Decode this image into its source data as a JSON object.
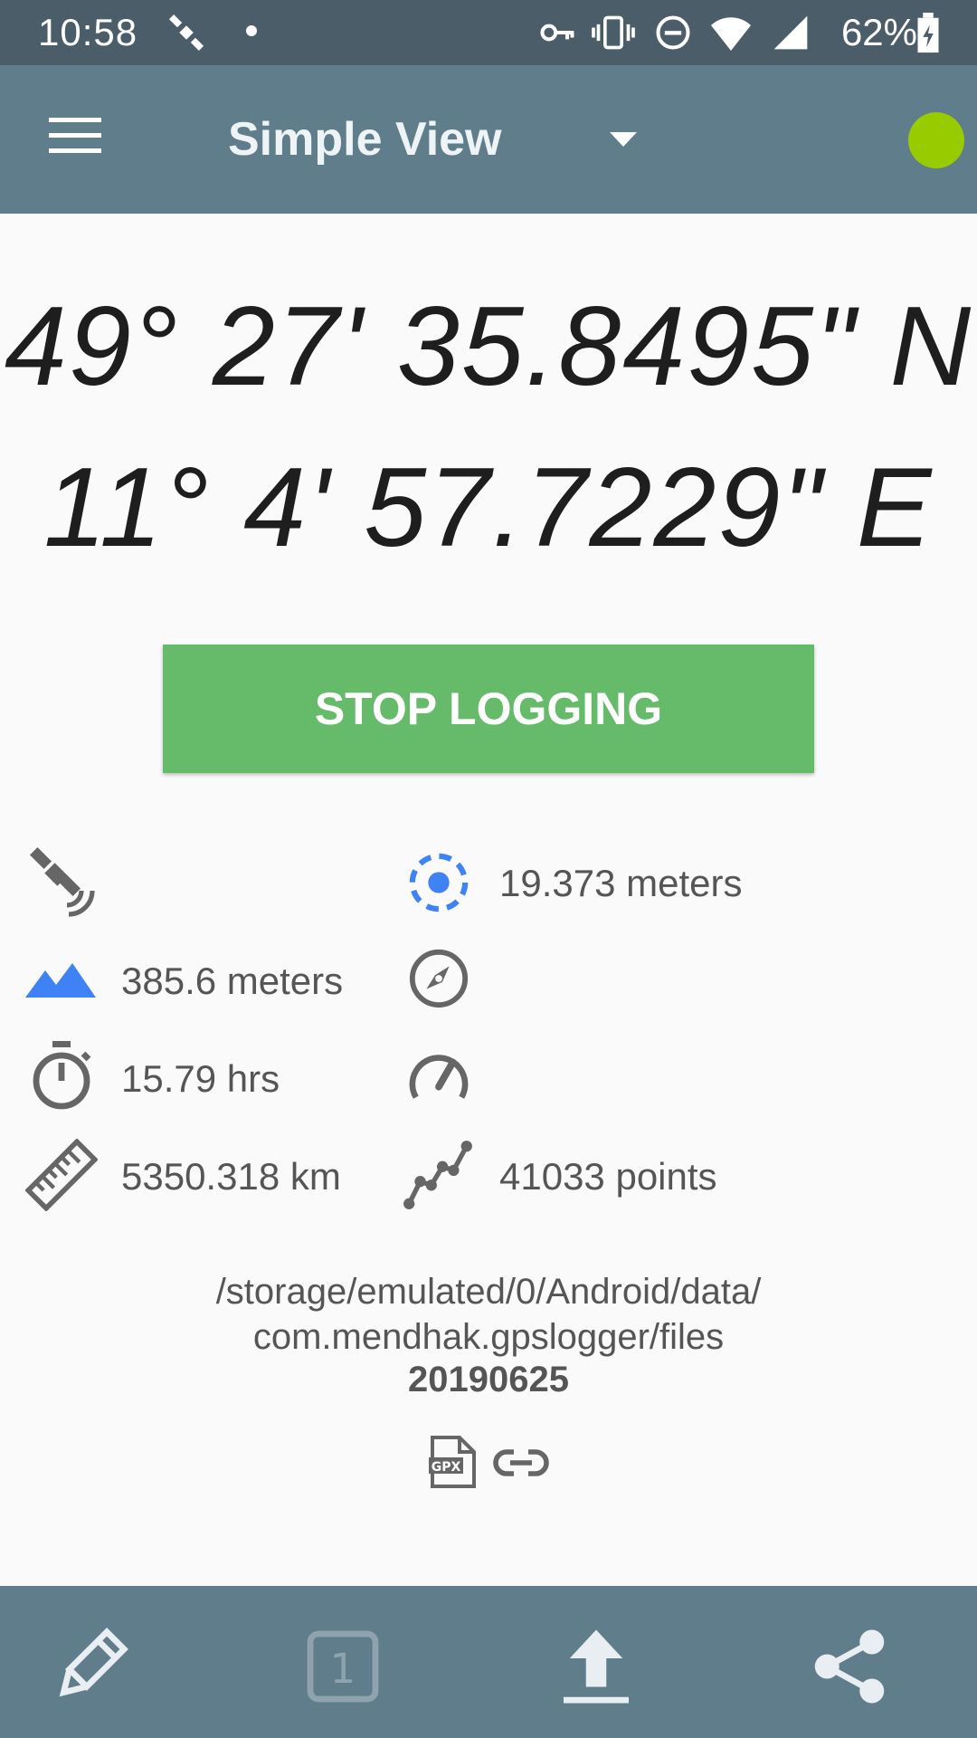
{
  "status_bar": {
    "time": "10:58",
    "battery": "62%",
    "icons": [
      "satellite-icon",
      "dot-icon",
      "vpn-key-icon",
      "vibrate-icon",
      "do-not-disturb-icon",
      "wifi-icon",
      "signal-icon",
      "battery-charging-icon"
    ]
  },
  "app_bar": {
    "title": "Simple View",
    "status_color": "#99cc00"
  },
  "coordinates": {
    "latitude": "49° 27' 35.8495\" N",
    "longitude": "11° 4' 57.7229\" E"
  },
  "actions": {
    "stop_logging": "STOP LOGGING"
  },
  "stats": {
    "satellites": "",
    "accuracy": "19.373 meters",
    "altitude": "385.6 meters",
    "bearing": "",
    "duration": "15.79 hrs",
    "speed": "",
    "distance": "5350.318 km",
    "points": "41033 points"
  },
  "file": {
    "path_line1": "/storage/emulated/0/Android/data/",
    "path_line2": "com.mendhak.gpslogger/files",
    "name": "20190625",
    "format_icons": [
      "gpx-file-icon",
      "link-icon"
    ]
  },
  "bottom_bar": {
    "items": [
      "pencil-icon",
      "one-point-icon",
      "upload-icon",
      "share-icon"
    ]
  },
  "colors": {
    "status_bar": "#4a5d69",
    "app_bar": "#607d8b",
    "button": "#66bb6a",
    "accent_blue": "#3f82f5"
  }
}
